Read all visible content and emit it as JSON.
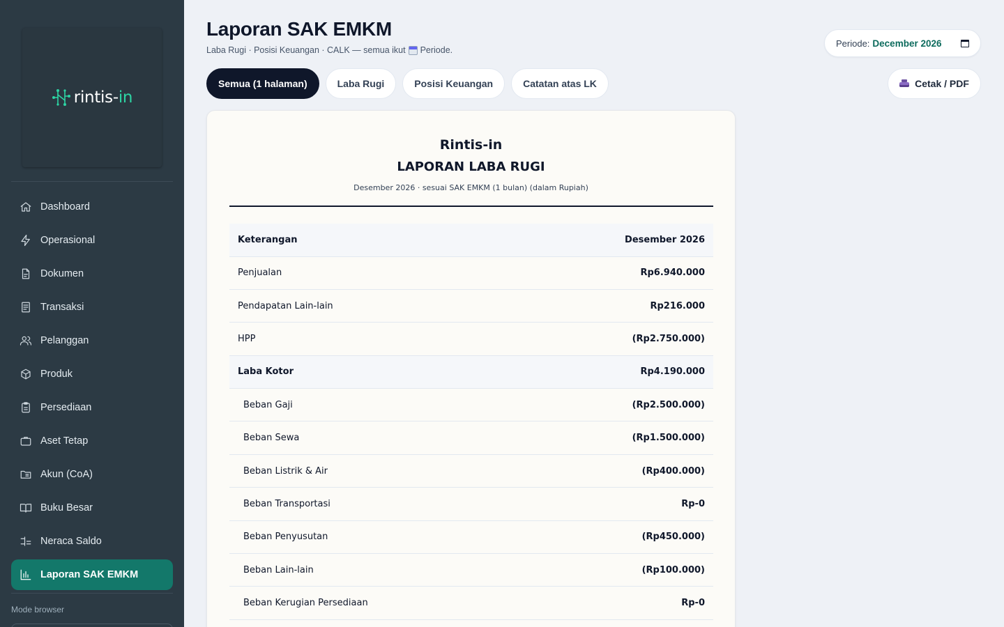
{
  "brand": {
    "name_main": "rintis",
    "name_sep": "-",
    "name_accent": "in",
    "accent_color": "#2dd4a3"
  },
  "sidebar": {
    "items": [
      {
        "label": "Dashboard",
        "icon": "home-icon",
        "active": false
      },
      {
        "label": "Operasional",
        "icon": "bolt-icon",
        "active": false
      },
      {
        "label": "Dokumen",
        "icon": "document-icon",
        "active": false
      },
      {
        "label": "Transaksi",
        "icon": "receipt-icon",
        "active": false
      },
      {
        "label": "Pelanggan",
        "icon": "users-icon",
        "active": false
      },
      {
        "label": "Produk",
        "icon": "box-icon",
        "active": false
      },
      {
        "label": "Persediaan",
        "icon": "clipboard-icon",
        "active": false
      },
      {
        "label": "Aset Tetap",
        "icon": "briefcase-icon",
        "active": false
      },
      {
        "label": "Akun (CoA)",
        "icon": "folder-icon",
        "active": false
      },
      {
        "label": "Buku Besar",
        "icon": "book-icon",
        "active": false
      },
      {
        "label": "Neraca Saldo",
        "icon": "scale-icon",
        "active": false
      },
      {
        "label": "Laporan SAK EMKM",
        "icon": "bar-chart-icon",
        "active": true
      }
    ],
    "mode_label": "Mode browser",
    "active_color": "#13786a"
  },
  "header": {
    "title": "Laporan SAK EMKM",
    "subtitle_before": "Laba Rugi · Posisi Keuangan · CALK — semua ikut",
    "subtitle_after": "Periode.",
    "period_label": "Periode:",
    "period_value": "December 2026",
    "print_label": "Cetak / PDF"
  },
  "tabs": [
    {
      "label": "Semua (1 halaman)",
      "active": true
    },
    {
      "label": "Laba Rugi",
      "active": false
    },
    {
      "label": "Posisi Keuangan",
      "active": false
    },
    {
      "label": "Catatan atas LK",
      "active": false
    }
  ],
  "report": {
    "company": "Rintis-in",
    "title": "LAPORAN LABA RUGI",
    "subtitle": "Desember 2026 · sesuai SAK EMKM (1 bulan) (dalam Rupiah)",
    "col_label": "Keterangan",
    "col_period": "Desember 2026",
    "rows": [
      {
        "label": "Penjualan",
        "value": "Rp6.940.000",
        "kind": "normal"
      },
      {
        "label": "Pendapatan Lain-lain",
        "value": "Rp216.000",
        "kind": "normal"
      },
      {
        "label": "HPP",
        "value": "(Rp2.750.000)",
        "kind": "normal"
      },
      {
        "label": "Laba Kotor",
        "value": "Rp4.190.000",
        "kind": "total"
      },
      {
        "label": "Beban Gaji",
        "value": "(Rp2.500.000)",
        "kind": "sub"
      },
      {
        "label": "Beban Sewa",
        "value": "(Rp1.500.000)",
        "kind": "sub"
      },
      {
        "label": "Beban Listrik & Air",
        "value": "(Rp400.000)",
        "kind": "sub"
      },
      {
        "label": "Beban Transportasi",
        "value": "Rp-0",
        "kind": "sub"
      },
      {
        "label": "Beban Penyusutan",
        "value": "(Rp450.000)",
        "kind": "sub"
      },
      {
        "label": "Beban Lain-lain",
        "value": "(Rp100.000)",
        "kind": "sub"
      },
      {
        "label": "Beban Kerugian Persediaan",
        "value": "Rp-0",
        "kind": "sub"
      }
    ]
  }
}
